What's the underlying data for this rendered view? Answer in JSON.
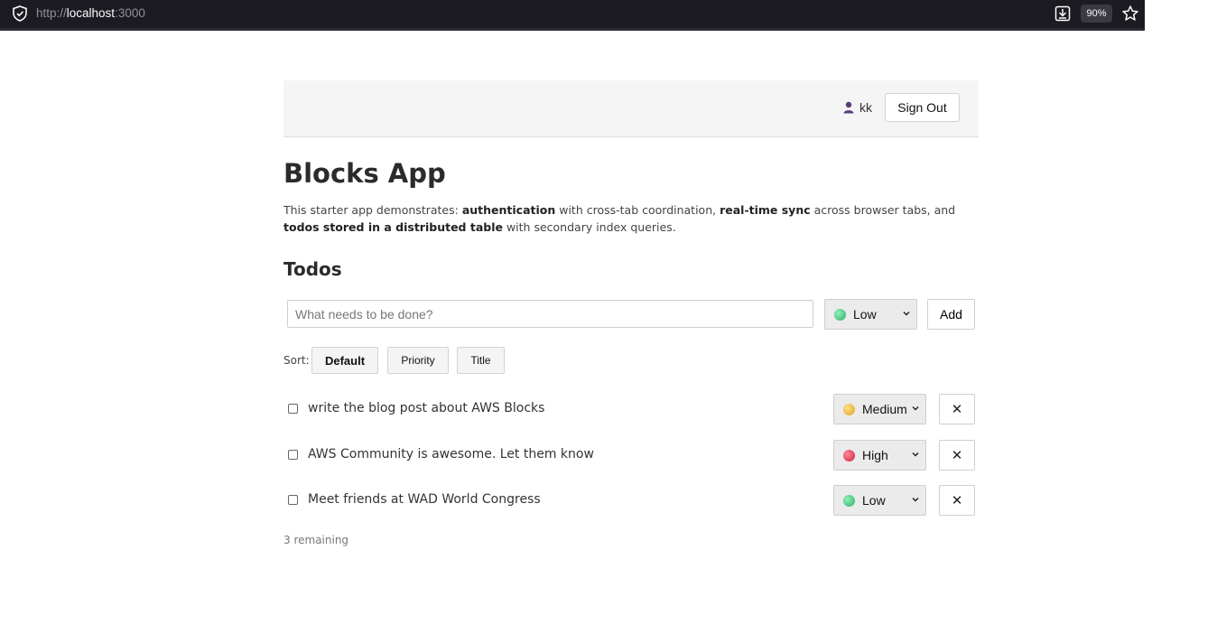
{
  "browser": {
    "url_prefix": "http://",
    "url_host": "localhost",
    "url_port": ":3000",
    "zoom": "90%"
  },
  "header": {
    "user_name": "kk",
    "signout_label": "Sign Out"
  },
  "page": {
    "title": "Blocks App",
    "intro": {
      "p1": "This starter app demonstrates: ",
      "b1": "authentication",
      "p2": " with cross-tab coordination, ",
      "b2": "real-time sync",
      "p3": " across browser tabs, and ",
      "b3": "todos stored in a distributed table",
      "p4": " with secondary index queries."
    },
    "section_title": "Todos"
  },
  "new_todo": {
    "placeholder": "What needs to be done?",
    "priority": "Low",
    "add_label": "Add"
  },
  "sort": {
    "label": "Sort:",
    "options": [
      "Default",
      "Priority",
      "Title"
    ],
    "active": "Default"
  },
  "todos": [
    {
      "text": "write the blog post about AWS Blocks",
      "priority": "Medium",
      "done": false
    },
    {
      "text": "AWS Community is awesome. Let them know",
      "priority": "High",
      "done": false
    },
    {
      "text": "Meet friends at WAD World Congress",
      "priority": "Low",
      "done": false
    }
  ],
  "remaining_text": "3 remaining",
  "colors": {
    "low": "#3fbf7f",
    "medium": "#e8b030",
    "high": "#e0354a"
  }
}
